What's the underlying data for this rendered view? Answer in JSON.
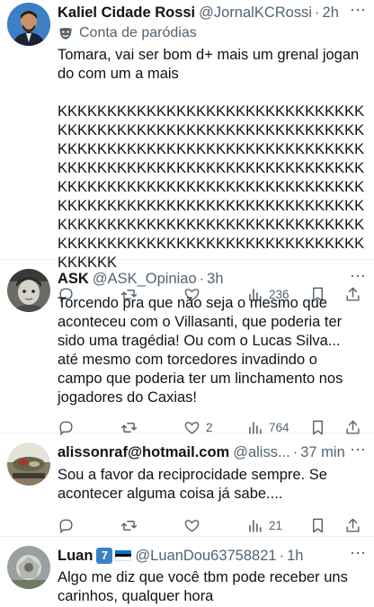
{
  "tweets": [
    {
      "name": "Kaliel Cidade Rossi",
      "handle": "@JornalKCRossi",
      "time": "2h",
      "parody_label": "Conta de paródias",
      "text": "Tomara, vai ser bom d+ mais um grenal jogando com um a mais\n\nKKKKKKKKKKKKKKKKKKKKKKKKKKKKKKKKKKKKKKKKKKKKKKKKKKKKKKKKKKKKKKKKKKKKKKKKKKKKKKKKKKKKKKKKKKKKKKKKKKKKKKKKKKKKKKKKKKKKKKKKKKKKKKKKKKKKKKKKKKKKKKKKKKKKKKKKKKKKKKKKKKKKKKKKKKKKKKKKKKKKKKKKKKKKKKKKKKKKKKKKKKKKKKKKKKKKKKKKKKKKKKKKKKKKKKKKKKKKKKKKKKKKKKKKKKKKKK",
      "replies": "",
      "retweets": "",
      "likes": "",
      "views": "236"
    },
    {
      "name": "ASK",
      "handle": "@ASK_Opiniao",
      "time": "3h",
      "text": "Torcendo pra que não seja o mesmo que aconteceu com o Villasanti, que poderia ter sido uma tragédia! Ou com o Lucas Silva... até mesmo com torcedores invadindo o campo que poderia ter um linchamento nos jogadores do Caxias!",
      "replies": "",
      "retweets": "",
      "likes": "2",
      "views": "764"
    },
    {
      "name": "alissonraf@hotmail.com",
      "handle": "@aliss...",
      "time": "37 min",
      "text": "Sou a favor da reciprocidade sempre. Se acontecer alguma coisa já sabe....",
      "replies": "",
      "retweets": "",
      "likes": "",
      "views": "21"
    },
    {
      "name": "Luan",
      "badge": "7",
      "handle": "@LuanDou63758821",
      "time": "1h",
      "text": "Algo me diz que você tbm pode receber uns carinhos, qualquer hora"
    }
  ],
  "icons": {
    "reply": "reply-icon",
    "retweet": "retweet-icon",
    "like": "heart-icon",
    "views": "views-icon",
    "bookmark": "bookmark-icon",
    "share": "share-icon",
    "more": "more-icon",
    "parody": "parody-mask-icon",
    "flag": "estonia-flag-icon"
  },
  "colors": {
    "text": "#0f1419",
    "secondary": "#536471",
    "divider": "#eff3f4",
    "badge": "#3b82c4"
  }
}
